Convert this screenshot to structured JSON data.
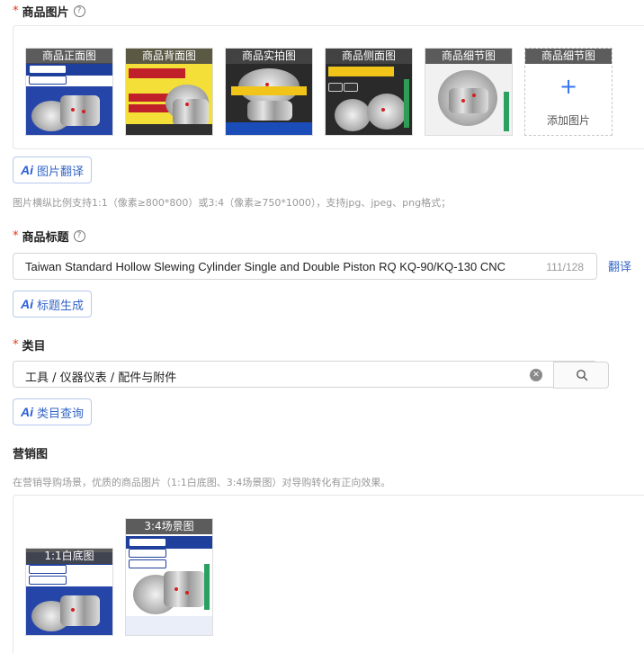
{
  "product_images": {
    "label": "商品图片",
    "items": [
      {
        "caption": "商品正面图",
        "theme": "white"
      },
      {
        "caption": "商品背面图",
        "theme": "yellow"
      },
      {
        "caption": "商品实拍图",
        "theme": "dark"
      },
      {
        "caption": "商品侧面图",
        "theme": "dark"
      },
      {
        "caption": "商品细节图",
        "theme": "light"
      }
    ],
    "add_slot": {
      "caption": "商品细节图",
      "label": "添加图片"
    },
    "translate_button": "图片翻译",
    "hint": "图片横纵比例支持1:1（像素≥800*800）或3:4（像素≥750*1000），支持jpg、jpeg、png格式；"
  },
  "product_title": {
    "label": "商品标题",
    "value": "Taiwan Standard Hollow Slewing Cylinder Single and Double Piston RQ KQ-90/KQ-130 CNC",
    "counter": "111/128",
    "translate_link": "翻译",
    "generate_button": "标题生成"
  },
  "category": {
    "label": "类目",
    "value": "工具 / 仪器仪表 / 配件与附件",
    "query_button": "类目查询"
  },
  "marketing": {
    "label": "营销图",
    "hint": "在营销导购场景，优质的商品图片（1:1白底图、3:4场景图）对导购转化有正向效果。",
    "items": [
      {
        "caption": "1:1白底图",
        "ratio": "1:1"
      },
      {
        "caption": "3:4场景图",
        "ratio": "3:4"
      }
    ]
  },
  "ai_badge": "Ai",
  "colors": {
    "accent": "#3566c8",
    "required": "#e8340b",
    "brand_blue": "#1f3f9c"
  }
}
